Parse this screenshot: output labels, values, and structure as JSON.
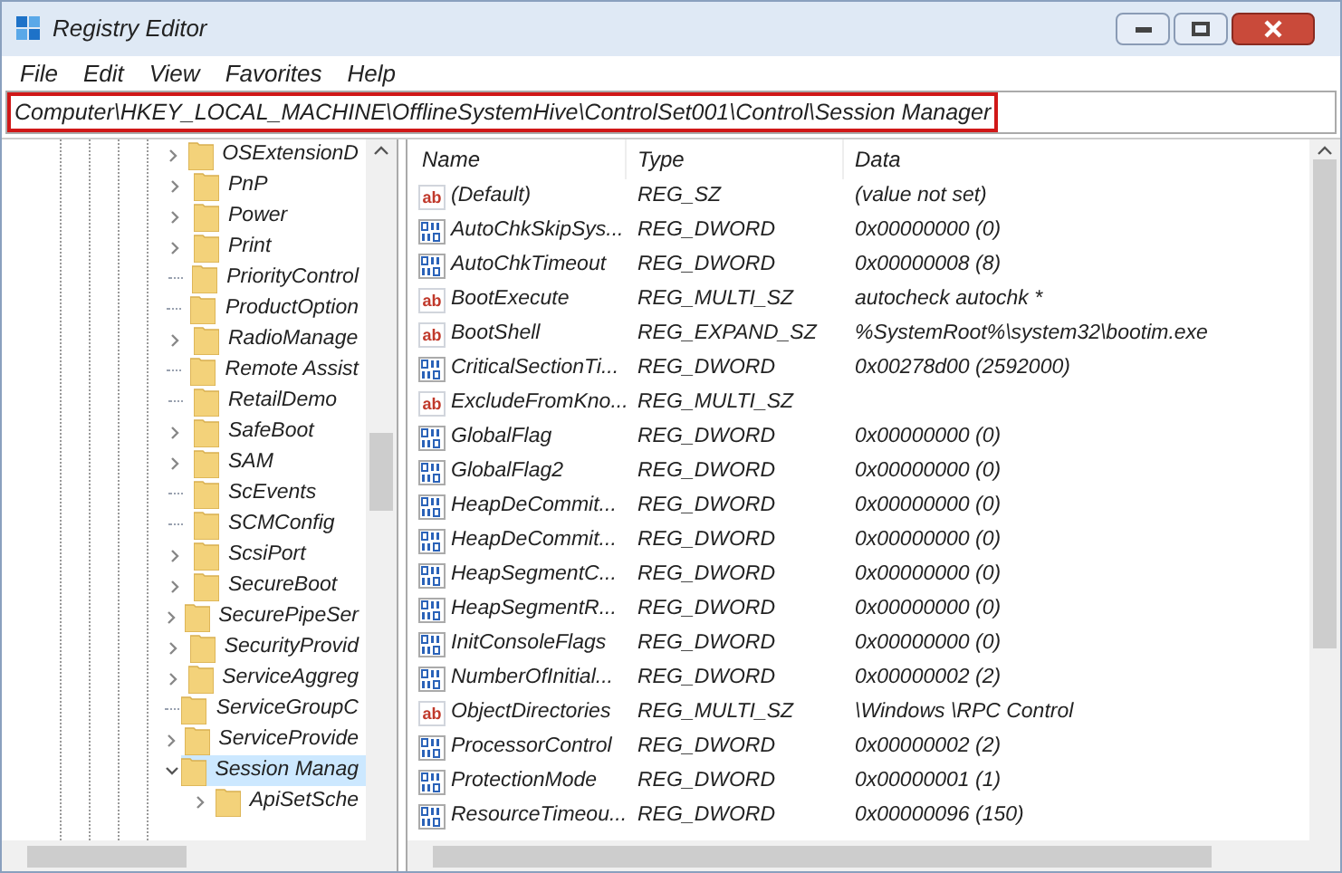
{
  "window": {
    "title": "Registry Editor"
  },
  "menu": [
    "File",
    "Edit",
    "View",
    "Favorites",
    "Help"
  ],
  "address": "Computer\\HKEY_LOCAL_MACHINE\\OfflineSystemHive\\ControlSet001\\Control\\Session Manager",
  "tree": [
    {
      "label": "OSExtensionD",
      "kind": "expandable",
      "expanded": false,
      "selected": false
    },
    {
      "label": "PnP",
      "kind": "expandable",
      "expanded": false,
      "selected": false
    },
    {
      "label": "Power",
      "kind": "expandable",
      "expanded": false,
      "selected": false
    },
    {
      "label": "Print",
      "kind": "expandable",
      "expanded": false,
      "selected": false
    },
    {
      "label": "PriorityControl",
      "kind": "leaf",
      "selected": false
    },
    {
      "label": "ProductOption",
      "kind": "leaf",
      "selected": false
    },
    {
      "label": "RadioManage",
      "kind": "expandable",
      "expanded": false,
      "selected": false
    },
    {
      "label": "Remote Assist",
      "kind": "leaf",
      "selected": false
    },
    {
      "label": "RetailDemo",
      "kind": "leaf",
      "selected": false
    },
    {
      "label": "SafeBoot",
      "kind": "expandable",
      "expanded": false,
      "selected": false
    },
    {
      "label": "SAM",
      "kind": "expandable",
      "expanded": false,
      "selected": false
    },
    {
      "label": "ScEvents",
      "kind": "leaf",
      "selected": false
    },
    {
      "label": "SCMConfig",
      "kind": "leaf",
      "selected": false
    },
    {
      "label": "ScsiPort",
      "kind": "expandable",
      "expanded": false,
      "selected": false
    },
    {
      "label": "SecureBoot",
      "kind": "expandable",
      "expanded": false,
      "selected": false
    },
    {
      "label": "SecurePipeSer",
      "kind": "expandable",
      "expanded": false,
      "selected": false
    },
    {
      "label": "SecurityProvid",
      "kind": "expandable",
      "expanded": false,
      "selected": false
    },
    {
      "label": "ServiceAggreg",
      "kind": "expandable",
      "expanded": false,
      "selected": false
    },
    {
      "label": "ServiceGroupC",
      "kind": "leaf",
      "selected": false
    },
    {
      "label": "ServiceProvide",
      "kind": "expandable",
      "expanded": false,
      "selected": false
    },
    {
      "label": "Session Manag",
      "kind": "expandable",
      "expanded": true,
      "selected": true,
      "children": [
        {
          "label": "ApiSetSche",
          "kind": "expandable",
          "expanded": false,
          "selected": false
        }
      ]
    }
  ],
  "table": {
    "columns": [
      "Name",
      "Type",
      "Data"
    ],
    "rows": [
      {
        "kind": "string",
        "icon_label": "ab",
        "name": "(Default)",
        "type": "REG_SZ",
        "data": "(value not set)"
      },
      {
        "kind": "binary",
        "name": "AutoChkSkipSys...",
        "type": "REG_DWORD",
        "data": "0x00000000 (0)"
      },
      {
        "kind": "binary",
        "name": "AutoChkTimeout",
        "type": "REG_DWORD",
        "data": "0x00000008 (8)"
      },
      {
        "kind": "string",
        "icon_label": "ab",
        "name": "BootExecute",
        "type": "REG_MULTI_SZ",
        "data": "autocheck autochk *"
      },
      {
        "kind": "string",
        "icon_label": "ab",
        "name": "BootShell",
        "type": "REG_EXPAND_SZ",
        "data": "%SystemRoot%\\system32\\bootim.exe"
      },
      {
        "kind": "binary",
        "name": "CriticalSectionTi...",
        "type": "REG_DWORD",
        "data": "0x00278d00 (2592000)"
      },
      {
        "kind": "string",
        "icon_label": "ab",
        "name": "ExcludeFromKno...",
        "type": "REG_MULTI_SZ"
      },
      {
        "kind": "binary",
        "name": "GlobalFlag",
        "type": "REG_DWORD",
        "data": "0x00000000 (0)"
      },
      {
        "kind": "binary",
        "name": "GlobalFlag2",
        "type": "REG_DWORD",
        "data": "0x00000000 (0)"
      },
      {
        "kind": "binary",
        "name": "HeapDeCommit...",
        "type": "REG_DWORD",
        "data": "0x00000000 (0)"
      },
      {
        "kind": "binary",
        "name": "HeapDeCommit...",
        "type": "REG_DWORD",
        "data": "0x00000000 (0)"
      },
      {
        "kind": "binary",
        "name": "HeapSegmentC...",
        "type": "REG_DWORD",
        "data": "0x00000000 (0)"
      },
      {
        "kind": "binary",
        "name": "HeapSegmentR...",
        "type": "REG_DWORD",
        "data": "0x00000000 (0)"
      },
      {
        "kind": "binary",
        "name": "InitConsoleFlags",
        "type": "REG_DWORD",
        "data": "0x00000000 (0)"
      },
      {
        "kind": "binary",
        "name": "NumberOfInitial...",
        "type": "REG_DWORD",
        "data": "0x00000002 (2)"
      },
      {
        "kind": "string",
        "icon_label": "ab",
        "name": "ObjectDirectories",
        "type": "REG_MULTI_SZ",
        "data": "\\Windows \\RPC Control"
      },
      {
        "kind": "binary",
        "name": "ProcessorControl",
        "type": "REG_DWORD",
        "data": "0x00000002 (2)"
      },
      {
        "kind": "binary",
        "name": "ProtectionMode",
        "type": "REG_DWORD",
        "data": "0x00000001 (1)"
      },
      {
        "kind": "binary",
        "name": "ResourceTimeou...",
        "type": "REG_DWORD",
        "data": "0x00000096 (150)"
      }
    ]
  }
}
